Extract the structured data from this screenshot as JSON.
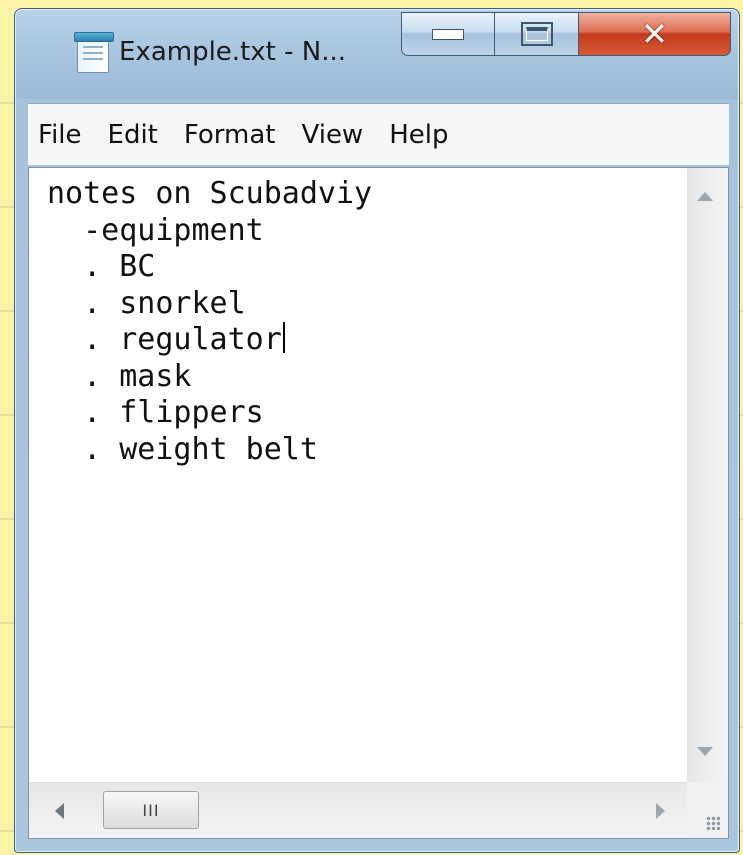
{
  "window": {
    "title": "Example.txt - N..."
  },
  "menu": {
    "items": [
      "File",
      "Edit",
      "Format",
      "View",
      "Help"
    ]
  },
  "editor": {
    "lines": [
      "notes on Scubadviy",
      "  -equipment",
      "  . BC",
      "  . snorkel",
      "  . regulator",
      "  . mask",
      "  . flippers",
      "  . weight belt"
    ],
    "caret_line_index": 4
  },
  "scrollbars": {
    "horizontal_thumb_grip": "III"
  },
  "icons": {
    "app": "notepad-icon",
    "minimize": "minimize-icon",
    "maximize": "maximize-icon",
    "close": "close-icon"
  },
  "colors": {
    "background": "#fbf3a6",
    "titlebar": "#a9c6e0",
    "close_button": "#c33a1c"
  }
}
